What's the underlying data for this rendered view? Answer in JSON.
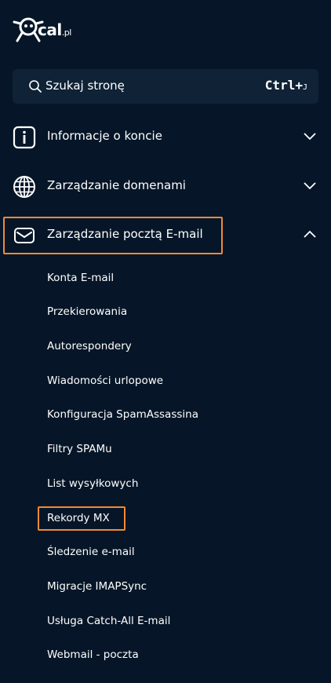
{
  "logo": {
    "name": "cal",
    "suffix": ".pl"
  },
  "search": {
    "label": "Szukaj stronę",
    "shortcut_main": "Ctrl+",
    "shortcut_key": "J"
  },
  "nav": [
    {
      "label": "Informacje o koncie",
      "icon": "info-icon",
      "expanded": false
    },
    {
      "label": "Zarządzanie domenami",
      "icon": "globe-icon",
      "expanded": false
    },
    {
      "label": "Zarządzanie pocztą E-mail",
      "icon": "envelope-icon",
      "expanded": true
    }
  ],
  "email_submenu": [
    "Konta E-mail",
    "Przekierowania",
    "Autorespondery",
    "Wiadomości urlopowe",
    "Konfiguracja SpamAssassina",
    "Filtry SPAMu",
    "List wysyłkowych",
    "Rekordy MX",
    "Śledzenie e-mail",
    "Migracje IMAPSync",
    "Usługa Catch-All E-mail",
    "Webmail - poczta"
  ],
  "colors": {
    "background": "#061628",
    "search_bg": "#0f2236",
    "highlight": "#f08a36",
    "text": "#ffffff"
  }
}
